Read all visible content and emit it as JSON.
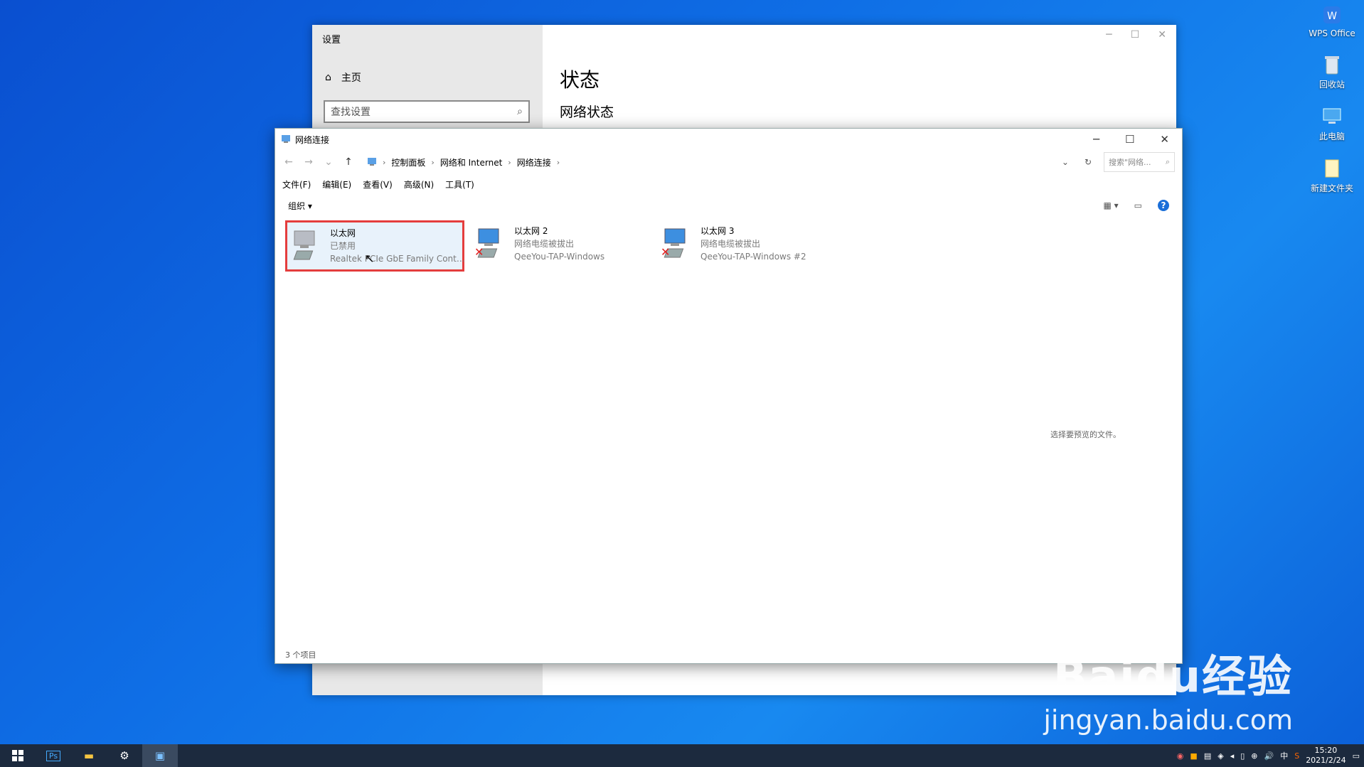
{
  "desktop": {
    "icons": [
      {
        "label": "WPS Office",
        "icon": "wps-office-icon"
      },
      {
        "label": "回收站",
        "icon": "recycle-bin-icon"
      },
      {
        "label": "此电脑",
        "icon": "this-pc-icon"
      },
      {
        "label": "新建文件夹",
        "icon": "folder-icon"
      }
    ]
  },
  "settings": {
    "title": "设置",
    "home_label": "主页",
    "search_placeholder": "查找设置",
    "heading": "状态",
    "subheading": "网络状态"
  },
  "network_window": {
    "title": "网络连接",
    "breadcrumb": [
      "控制面板",
      "网络和 Internet",
      "网络连接"
    ],
    "search_placeholder": "搜索\"网络...",
    "menu": [
      "文件(F)",
      "编辑(E)",
      "查看(V)",
      "高级(N)",
      "工具(T)"
    ],
    "organize_label": "组织",
    "connections": [
      {
        "name": "以太网",
        "status": "已禁用",
        "device": "Realtek PCIe GbE Family Contr...",
        "selected": true,
        "disconnected": false
      },
      {
        "name": "以太网 2",
        "status": "网络电缆被拔出",
        "device": "QeeYou-TAP-Windows",
        "selected": false,
        "disconnected": true
      },
      {
        "name": "以太网 3",
        "status": "网络电缆被拔出",
        "device": "QeeYou-TAP-Windows #2",
        "selected": false,
        "disconnected": true
      }
    ],
    "preview_text": "选择要预览的文件。",
    "status_bar": "3 个项目"
  },
  "taskbar": {
    "ime": "中",
    "time": "15:20",
    "date": "2021/2/24"
  },
  "watermark": {
    "brand": "Baidu经验",
    "url": "jingyan.baidu.com"
  },
  "colors": {
    "desktop": "#0f6fe6",
    "selection_border": "#e43d3d",
    "selection_fill": "#e8f2fb",
    "taskbar": "#1c2a3e"
  }
}
